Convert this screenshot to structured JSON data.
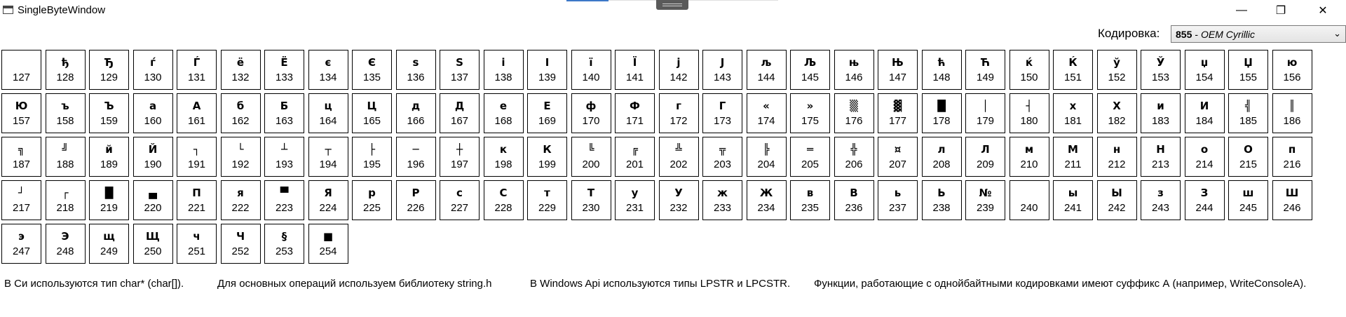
{
  "window": {
    "title": "SingleByteWindow",
    "controls": {
      "minimize": "—",
      "maximize": "❐",
      "close": "✕"
    }
  },
  "encoding": {
    "label": "Кодировка:",
    "selected_code": "855",
    "selected_separator": "-",
    "selected_name": "OEM Cyrillic",
    "arrow": "⌄"
  },
  "cells": [
    {
      "glyph": "",
      "code": "127"
    },
    {
      "glyph": "ђ",
      "code": "128"
    },
    {
      "glyph": "Ђ",
      "code": "129"
    },
    {
      "glyph": "ѓ",
      "code": "130"
    },
    {
      "glyph": "Ѓ",
      "code": "131"
    },
    {
      "glyph": "ё",
      "code": "132"
    },
    {
      "glyph": "Ё",
      "code": "133"
    },
    {
      "glyph": "є",
      "code": "134"
    },
    {
      "glyph": "Є",
      "code": "135"
    },
    {
      "glyph": "ѕ",
      "code": "136"
    },
    {
      "glyph": "Ѕ",
      "code": "137"
    },
    {
      "glyph": "і",
      "code": "138"
    },
    {
      "glyph": "І",
      "code": "139"
    },
    {
      "glyph": "ї",
      "code": "140"
    },
    {
      "glyph": "Ї",
      "code": "141"
    },
    {
      "glyph": "ј",
      "code": "142"
    },
    {
      "glyph": "Ј",
      "code": "143"
    },
    {
      "glyph": "љ",
      "code": "144"
    },
    {
      "glyph": "Љ",
      "code": "145"
    },
    {
      "glyph": "њ",
      "code": "146"
    },
    {
      "glyph": "Њ",
      "code": "147"
    },
    {
      "glyph": "ћ",
      "code": "148"
    },
    {
      "glyph": "Ћ",
      "code": "149"
    },
    {
      "glyph": "ќ",
      "code": "150"
    },
    {
      "glyph": "Ќ",
      "code": "151"
    },
    {
      "glyph": "ў",
      "code": "152"
    },
    {
      "glyph": "Ў",
      "code": "153"
    },
    {
      "glyph": "џ",
      "code": "154"
    },
    {
      "glyph": "Џ",
      "code": "155"
    },
    {
      "glyph": "ю",
      "code": "156"
    },
    {
      "glyph": "Ю",
      "code": "157"
    },
    {
      "glyph": "ъ",
      "code": "158"
    },
    {
      "glyph": "Ъ",
      "code": "159"
    },
    {
      "glyph": "а",
      "code": "160"
    },
    {
      "glyph": "А",
      "code": "161"
    },
    {
      "glyph": "б",
      "code": "162"
    },
    {
      "glyph": "Б",
      "code": "163"
    },
    {
      "glyph": "ц",
      "code": "164"
    },
    {
      "glyph": "Ц",
      "code": "165"
    },
    {
      "glyph": "д",
      "code": "166"
    },
    {
      "glyph": "Д",
      "code": "167"
    },
    {
      "glyph": "е",
      "code": "168"
    },
    {
      "glyph": "Е",
      "code": "169"
    },
    {
      "glyph": "ф",
      "code": "170"
    },
    {
      "glyph": "Ф",
      "code": "171"
    },
    {
      "glyph": "г",
      "code": "172"
    },
    {
      "glyph": "Г",
      "code": "173"
    },
    {
      "glyph": "«",
      "code": "174"
    },
    {
      "glyph": "»",
      "code": "175"
    },
    {
      "glyph": "▒",
      "code": "176"
    },
    {
      "glyph": "▓",
      "code": "177"
    },
    {
      "glyph": "█",
      "code": "178"
    },
    {
      "glyph": "│",
      "code": "179"
    },
    {
      "glyph": "┤",
      "code": "180"
    },
    {
      "glyph": "х",
      "code": "181"
    },
    {
      "glyph": "Х",
      "code": "182"
    },
    {
      "glyph": "и",
      "code": "183"
    },
    {
      "glyph": "И",
      "code": "184"
    },
    {
      "glyph": "╣",
      "code": "185"
    },
    {
      "glyph": "║",
      "code": "186"
    },
    {
      "glyph": "╗",
      "code": "187"
    },
    {
      "glyph": "╝",
      "code": "188"
    },
    {
      "glyph": "й",
      "code": "189"
    },
    {
      "glyph": "Й",
      "code": "190"
    },
    {
      "glyph": "┐",
      "code": "191"
    },
    {
      "glyph": "└",
      "code": "192"
    },
    {
      "glyph": "┴",
      "code": "193"
    },
    {
      "glyph": "┬",
      "code": "194"
    },
    {
      "glyph": "├",
      "code": "195"
    },
    {
      "glyph": "─",
      "code": "196"
    },
    {
      "glyph": "┼",
      "code": "197"
    },
    {
      "glyph": "к",
      "code": "198"
    },
    {
      "glyph": "К",
      "code": "199"
    },
    {
      "glyph": "╚",
      "code": "200"
    },
    {
      "glyph": "╔",
      "code": "201"
    },
    {
      "glyph": "╩",
      "code": "202"
    },
    {
      "glyph": "╦",
      "code": "203"
    },
    {
      "glyph": "╠",
      "code": "204"
    },
    {
      "glyph": "═",
      "code": "205"
    },
    {
      "glyph": "╬",
      "code": "206"
    },
    {
      "glyph": "¤",
      "code": "207"
    },
    {
      "glyph": "л",
      "code": "208"
    },
    {
      "glyph": "Л",
      "code": "209"
    },
    {
      "glyph": "м",
      "code": "210"
    },
    {
      "glyph": "М",
      "code": "211"
    },
    {
      "glyph": "н",
      "code": "212"
    },
    {
      "glyph": "Н",
      "code": "213"
    },
    {
      "glyph": "о",
      "code": "214"
    },
    {
      "glyph": "О",
      "code": "215"
    },
    {
      "glyph": "п",
      "code": "216"
    },
    {
      "glyph": "┘",
      "code": "217"
    },
    {
      "glyph": "┌",
      "code": "218"
    },
    {
      "glyph": "█",
      "code": "219"
    },
    {
      "glyph": "▄",
      "code": "220"
    },
    {
      "glyph": "П",
      "code": "221"
    },
    {
      "glyph": "я",
      "code": "222"
    },
    {
      "glyph": "▀",
      "code": "223"
    },
    {
      "glyph": "Я",
      "code": "224"
    },
    {
      "glyph": "р",
      "code": "225"
    },
    {
      "glyph": "Р",
      "code": "226"
    },
    {
      "glyph": "с",
      "code": "227"
    },
    {
      "glyph": "С",
      "code": "228"
    },
    {
      "glyph": "т",
      "code": "229"
    },
    {
      "glyph": "Т",
      "code": "230"
    },
    {
      "glyph": "у",
      "code": "231"
    },
    {
      "glyph": "У",
      "code": "232"
    },
    {
      "glyph": "ж",
      "code": "233"
    },
    {
      "glyph": "Ж",
      "code": "234"
    },
    {
      "glyph": "в",
      "code": "235"
    },
    {
      "glyph": "В",
      "code": "236"
    },
    {
      "glyph": "ь",
      "code": "237"
    },
    {
      "glyph": "Ь",
      "code": "238"
    },
    {
      "glyph": "№",
      "code": "239"
    },
    {
      "glyph": "",
      "code": "240"
    },
    {
      "glyph": "ы",
      "code": "241"
    },
    {
      "glyph": "Ы",
      "code": "242"
    },
    {
      "glyph": "з",
      "code": "243"
    },
    {
      "glyph": "З",
      "code": "244"
    },
    {
      "glyph": "ш",
      "code": "245"
    },
    {
      "glyph": "Ш",
      "code": "246"
    },
    {
      "glyph": "э",
      "code": "247"
    },
    {
      "glyph": "Э",
      "code": "248"
    },
    {
      "glyph": "щ",
      "code": "249"
    },
    {
      "glyph": "Щ",
      "code": "250"
    },
    {
      "glyph": "ч",
      "code": "251"
    },
    {
      "glyph": "Ч",
      "code": "252"
    },
    {
      "glyph": "§",
      "code": "253"
    },
    {
      "glyph": "■",
      "code": "254"
    }
  ],
  "info": [
    "В Си используются тип char* (char[]).",
    "Для основных операций используем библиотеку string.h",
    "В Windows Api используются типы LPSTR и LPCSTR.",
    "Функции, работающие с однойбайтными кодировками имеют суффикс А (например, WriteConsoleA)."
  ]
}
